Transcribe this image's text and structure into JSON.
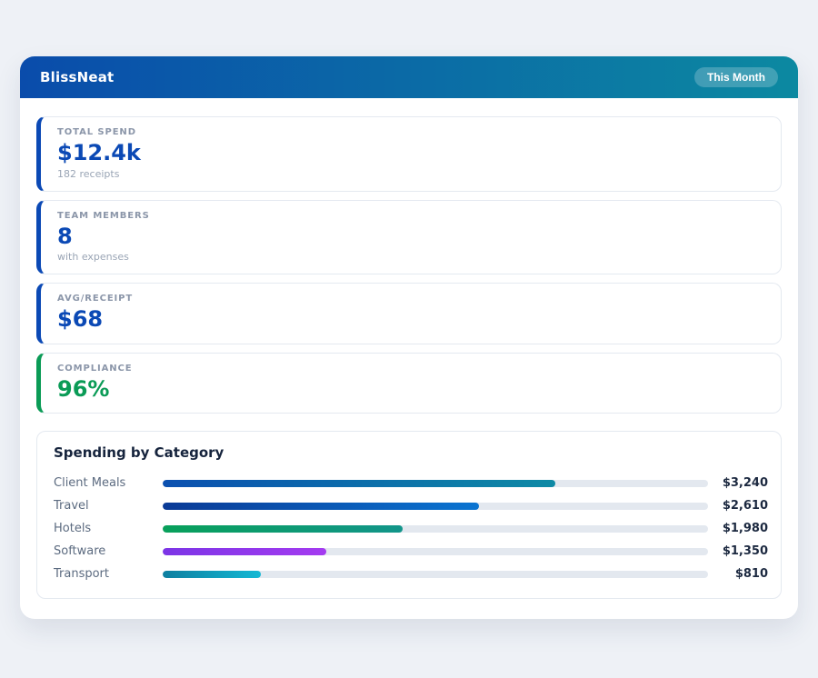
{
  "page": {
    "background": "#eef1f6"
  },
  "header": {
    "title": "BlissNeat",
    "badge_label": "This Month",
    "gradient_from": "#0a4cab",
    "gradient_to": "#0c89a1"
  },
  "stats": [
    {
      "label": "TOTAL SPEND",
      "value": "$12.4k",
      "sub": "182 receipts",
      "accent": "#0b49b5",
      "value_color": "#0b49b5"
    },
    {
      "label": "TEAM MEMBERS",
      "value": "8",
      "sub": "with expenses",
      "accent": "#0b49b5",
      "value_color": "#0b49b5"
    },
    {
      "label": "AVG/RECEIPT",
      "value": "$68",
      "sub": "",
      "accent": "#0b49b5",
      "value_color": "#0b49b5"
    },
    {
      "label": "COMPLIANCE",
      "value": "96%",
      "sub": "",
      "accent": "#0a9b56",
      "value_color": "#0a9b56"
    }
  ],
  "chart": {
    "title": "Spending by Category",
    "track_color": "#e3e8ef",
    "rows": [
      {
        "label": "Client Meals",
        "value_label": "$3,240",
        "amount": 3240,
        "pct": 72,
        "color_from": "#0b50b0",
        "color_to": "#0e8aa5"
      },
      {
        "label": "Travel",
        "value_label": "$2,610",
        "amount": 2610,
        "pct": 58,
        "color_from": "#0a3a96",
        "color_to": "#0b74d1"
      },
      {
        "label": "Hotels",
        "value_label": "$1,980",
        "amount": 1980,
        "pct": 44,
        "color_from": "#08a05a",
        "color_to": "#12958a"
      },
      {
        "label": "Software",
        "value_label": "$1,350",
        "amount": 1350,
        "pct": 30,
        "color_from": "#7c35e6",
        "color_to": "#a43bf0"
      },
      {
        "label": "Transport",
        "value_label": "$810",
        "amount": 810,
        "pct": 18,
        "color_from": "#0e7fa0",
        "color_to": "#14b8d4"
      }
    ]
  },
  "chart_data": {
    "type": "bar",
    "orientation": "horizontal",
    "title": "Spending by Category",
    "categories": [
      "Client Meals",
      "Travel",
      "Hotels",
      "Software",
      "Transport"
    ],
    "values": [
      3240,
      2610,
      1980,
      1350,
      810
    ],
    "value_labels": [
      "$3,240",
      "$2,610",
      "$1,980",
      "$1,350",
      "$810"
    ],
    "xlim": [
      0,
      4500
    ],
    "grid": false,
    "legend": false
  }
}
